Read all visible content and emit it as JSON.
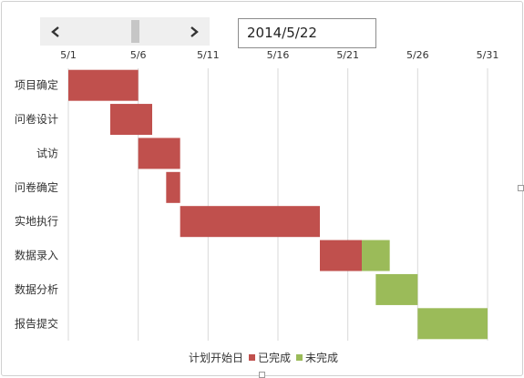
{
  "date_display": "2014/5/22",
  "scrollbar": {
    "position": 0.6
  },
  "chart_data": {
    "type": "bar",
    "orientation": "horizontal",
    "stacked": true,
    "categories": [
      "项目确定",
      "问卷设计",
      "试访",
      "问卷确定",
      "实地执行",
      "数据录入",
      "数据分析",
      "报告提交"
    ],
    "x_ticks": [
      "5/1",
      "5/6",
      "5/11",
      "5/16",
      "5/21",
      "5/26",
      "5/31"
    ],
    "x_tick_values": [
      0,
      5,
      10,
      15,
      20,
      25,
      30
    ],
    "xlim": [
      0,
      30
    ],
    "grid": true,
    "legend_position": "bottom",
    "series": [
      {
        "name": "计划开始日",
        "color": "none",
        "values": [
          0,
          3,
          5,
          7,
          8,
          18,
          22,
          25
        ]
      },
      {
        "name": "已完成",
        "color": "#c0504d",
        "values": [
          5,
          3,
          3,
          1,
          10,
          3,
          0,
          0
        ]
      },
      {
        "name": "未完成",
        "color": "#9bbb59",
        "values": [
          0,
          0,
          0,
          0,
          0,
          2,
          3,
          5
        ]
      }
    ]
  }
}
